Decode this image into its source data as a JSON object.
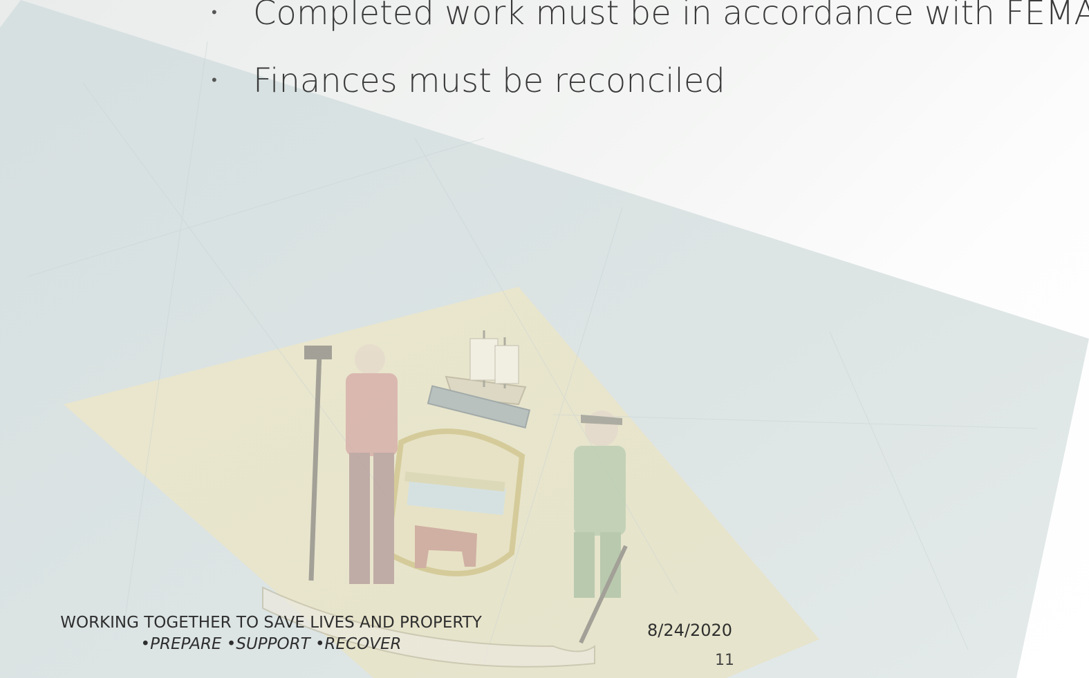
{
  "slide": {
    "bullets": [
      {
        "text": "Completed work must be in accordance with FEMA"
      },
      {
        "text": "Finances must be reconciled"
      }
    ],
    "footer": {
      "motto_line1": "WORKING TOGETHER TO SAVE LIVES AND PROPERTY",
      "motto_line2": "•PREPARE •SUPPORT •RECOVER",
      "date": "8/24/2020",
      "page_number": "11"
    },
    "background": {
      "image": "delaware-state-flag",
      "colors": {
        "flag_blue": "#cfdbdc",
        "diamond_buff": "#e9e3c4",
        "accent_red": "#c98b86",
        "accent_green": "#a9c3a0"
      }
    }
  }
}
